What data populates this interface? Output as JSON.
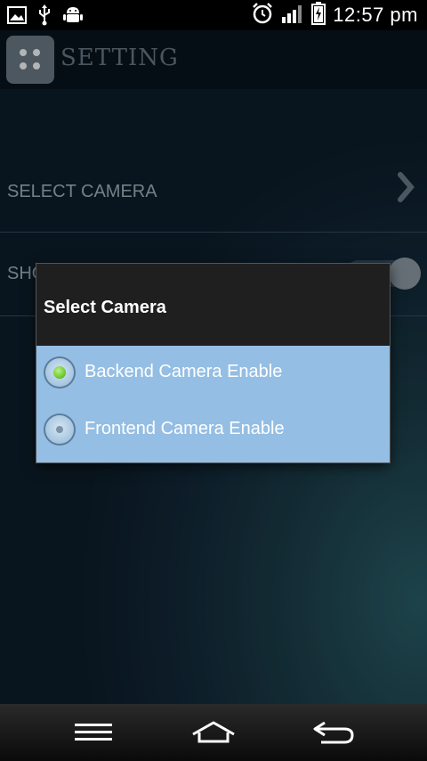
{
  "status_bar": {
    "time": "12:57 pm",
    "icons": [
      "gallery-icon",
      "usb-icon",
      "android-icon",
      "alarm-icon",
      "signal-icon",
      "battery-charging-icon"
    ]
  },
  "header": {
    "title": "SETTING",
    "icon": "grid-icon"
  },
  "settings": [
    {
      "label": "SELECT CAMERA",
      "icon": "chevron-right-icon"
    },
    {
      "label": "SHO",
      "icon": "toggle-switch"
    }
  ],
  "dialog": {
    "title": "Select Camera",
    "options": [
      {
        "label": "Backend Camera Enable",
        "selected": true
      },
      {
        "label": "Frontend Camera Enable",
        "selected": false
      }
    ]
  },
  "navbar": {
    "buttons": [
      "menu-icon",
      "home-icon",
      "back-icon"
    ]
  },
  "colors": {
    "dialog_body": "#94bee4",
    "dialog_title_bg": "#1f1f1f",
    "radio_selected": "#6fce2f"
  }
}
